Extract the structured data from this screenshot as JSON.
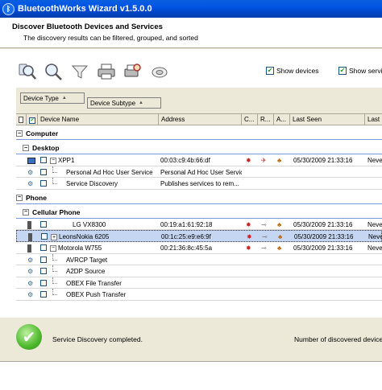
{
  "window": {
    "title": "BluetoothWorks Wizard  v1.5.0.0"
  },
  "header": {
    "title": "Discover Bluetooth Devices and Services",
    "subtitle": "The discovery results can be filtered, grouped, and sorted"
  },
  "toolbar": {
    "buttons": [
      {
        "icon": "discover-devices-icon"
      },
      {
        "icon": "discover-services-icon"
      },
      {
        "icon": "filter-icon"
      },
      {
        "icon": "print-icon"
      },
      {
        "icon": "print-preview-icon"
      },
      {
        "icon": "refresh-icon"
      }
    ]
  },
  "options": {
    "show_devices": {
      "label": "Show devices",
      "checked": true
    },
    "show_services": {
      "label": "Show servic",
      "checked": true
    }
  },
  "grouping": {
    "group1": "Device Type",
    "group2": "Device Subtype"
  },
  "grid": {
    "columns": {
      "name": "Device Name",
      "address": "Address",
      "c": "C...",
      "r": "R...",
      "a": "A...",
      "last_seen": "Last Seen",
      "last": "Last I"
    },
    "groups": {
      "computer": "Computer",
      "desktop": "Desktop",
      "phone": "Phone",
      "cellular": "Cellular Phone"
    },
    "rows": {
      "xpp1": {
        "name": "XPP1",
        "address": "00:03:c9:4b:66:df",
        "last_seen": "05/30/2009 21:33:16",
        "last": "Never"
      },
      "pan": {
        "name": "Personal Ad Hoc User Service",
        "address": "Personal Ad Hoc User Service"
      },
      "sd": {
        "name": "Service Discovery",
        "address": "Publishes services to rem..."
      },
      "lg": {
        "name": "LG VX8300",
        "address": "00:19:a1:61:92:18",
        "last_seen": "05/30/2009 21:33:16",
        "last": "Never"
      },
      "nokia": {
        "name": "LeonsNokia 6205",
        "address": "00:1c:25:e9:e6:9f",
        "last_seen": "05/30/2009 21:33:16",
        "last": "Never"
      },
      "moto": {
        "name": "Motorola W755",
        "address": "00:21:36:8c:45:5a",
        "last_seen": "05/30/2009 21:33:16",
        "last": "Never"
      },
      "avrcp": {
        "name": "AVRCP Target"
      },
      "a2dp": {
        "name": "A2DP Source"
      },
      "obexft": {
        "name": "OBEX File Transfer"
      },
      "obexpush": {
        "name": "OBEX Push Transfer"
      }
    }
  },
  "status": {
    "message": "Service Discovery completed.",
    "count_label": "Number of discovered devices:"
  },
  "colors": {
    "titlebar": "#0054E3",
    "selected_row": "#C5D6F2",
    "group_line": "#7A96DF",
    "check_green": "#21A121"
  }
}
